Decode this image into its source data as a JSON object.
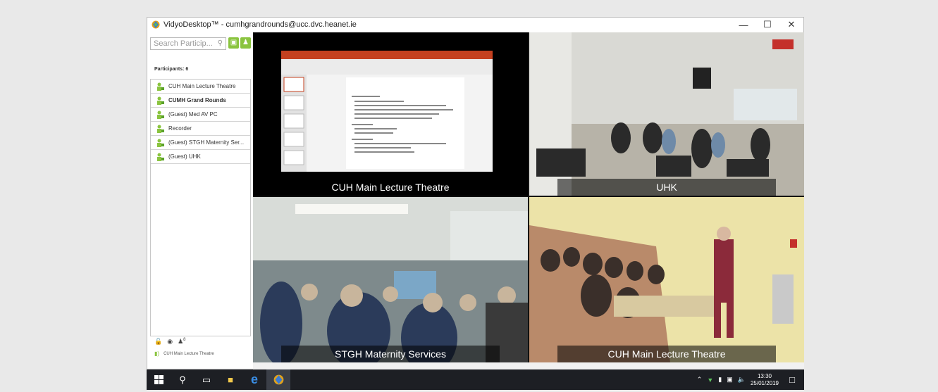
{
  "window": {
    "title": "VidyoDesktop™ - cumhgrandrounds@ucc.dvc.heanet.ie",
    "controls": {
      "minimize": "—",
      "maximize": "☐",
      "close": "✕"
    }
  },
  "sidebar": {
    "search_placeholder": "Search Particip...",
    "participants_label": "Participants: 6",
    "participants": [
      {
        "name": "CUH Main Lecture Theatre",
        "bold": false
      },
      {
        "name": "CUMH Grand Rounds",
        "bold": true
      },
      {
        "name": "(Guest) Med AV PC",
        "bold": false
      },
      {
        "name": "Recorder",
        "bold": false
      },
      {
        "name": "(Guest) STGH Maternity Ser...",
        "bold": false
      },
      {
        "name": "(Guest) UHK",
        "bold": false
      }
    ],
    "footer_count": "8",
    "speaking_label": "CUH Main Lecture Theatre"
  },
  "videos": {
    "tile1": {
      "caption": "CUH Main Lecture Theatre"
    },
    "tile2": {
      "caption": "UHK"
    },
    "tile3": {
      "caption": "STGH Maternity Services"
    },
    "tile4": {
      "caption": "CUH Main Lecture Theatre"
    }
  },
  "taskbar": {
    "time": "13:30",
    "date": "25/01/2019"
  },
  "colors": {
    "accent_green": "#8ac43f",
    "taskbar_bg": "#1d1f24",
    "ppt_red": "#c4401f"
  }
}
